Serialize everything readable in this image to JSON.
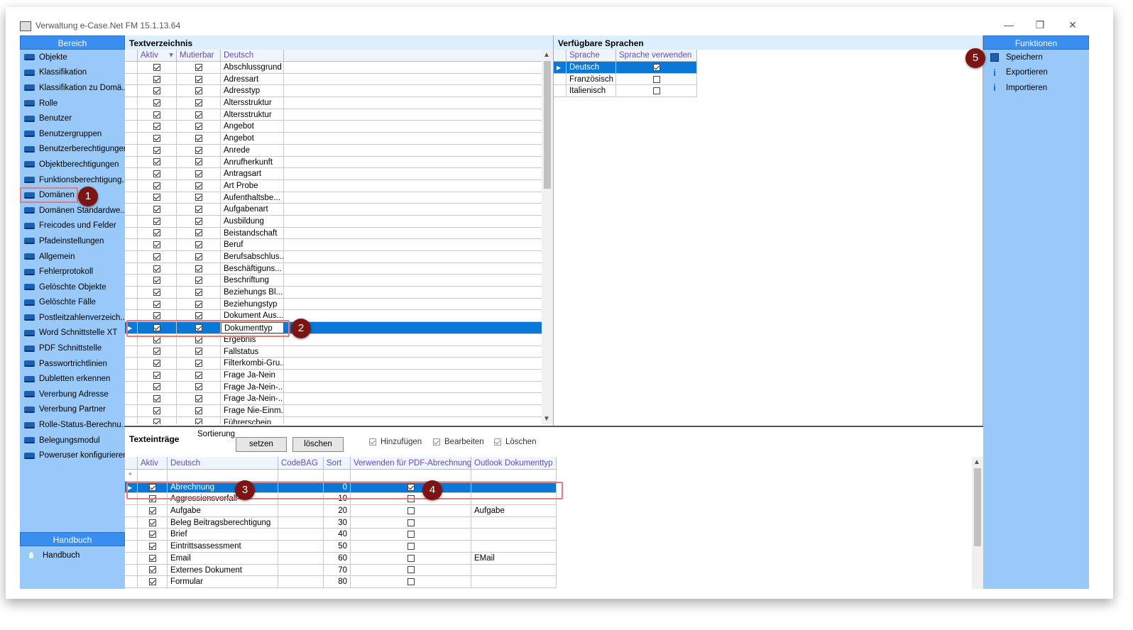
{
  "window": {
    "title": "Verwaltung e-Case.Net FM 15.1.13.64",
    "minimize": "—",
    "restore": "❐",
    "close": "✕"
  },
  "bereich": {
    "header": "Bereich",
    "items": [
      "Objekte",
      "Klassifikation",
      "Klassifikation zu Domä...",
      "Rolle",
      "Benutzer",
      "Benutzergruppen",
      "Benutzerberechtigungen",
      "Objektberechtigungen",
      "Funktionsberechtigung...",
      "Domänen",
      "Domänen Standardwe...",
      "Freicodes und Felder",
      "Pfadeinstellungen",
      "Allgemein",
      "Fehlerprotokoll",
      "Gelöschte Objekte",
      "Gelöschte Fälle",
      "Postleitzahlenverzeich...",
      "Word Schnittstelle XT",
      "PDF Schnittstelle",
      "Passwortrichtlinien",
      "Dubletten erkennen",
      "Vererbung Adresse",
      "Vererbung Partner",
      "Rolle-Status-Berechnu...",
      "Belegungsmodul",
      "Poweruser konfigurieren"
    ],
    "selected_index": 9
  },
  "handbuch": {
    "header": "Handbuch",
    "item": "Handbuch"
  },
  "textverzeichnis": {
    "title": "Textverzeichnis",
    "columns": [
      "Aktiv",
      "Mutierbar",
      "Deutsch"
    ],
    "rows": [
      "Abschlussgrund",
      "Adressart",
      "Adresstyp",
      "Altersstruktur",
      "Altersstruktur",
      "Angebot",
      "Angebot",
      "Anrede",
      "Anrufherkunft",
      "Antragsart",
      "Art Probe",
      "Aufenthaltsbe...",
      "Aufgabenart",
      "Ausbildung",
      "Beistandschaft",
      "Beruf",
      "Berufsabschlus...",
      "Beschäftiguns...",
      "Beschriftung",
      "Beziehungs Bl...",
      "Beziehungstyp",
      "Dokument Aus...",
      "Dokumenttyp",
      "Ergebnis",
      "Fallstatus",
      "Filterkombi-Gru...",
      "Frage Ja-Nein",
      "Frage Ja-Nein-...",
      "Frage Ja-Nein-...",
      "Frage Nie-Einm...",
      "Führerschein"
    ],
    "selected_index": 22,
    "sort_arrow": "▾"
  },
  "sprachen": {
    "title": "Verfügbare Sprachen",
    "columns": [
      "Sprache",
      "Sprache verwenden"
    ],
    "rows": [
      {
        "name": "Deutsch",
        "use": true
      },
      {
        "name": "Französisch",
        "use": false
      },
      {
        "name": "Italienisch",
        "use": false
      }
    ],
    "selected_index": 0
  },
  "funktionen": {
    "header": "Funktionen",
    "items": [
      {
        "label": "Speichern",
        "icon": "save-icon"
      },
      {
        "label": "Exportieren",
        "icon": "info-icon"
      },
      {
        "label": "Importieren",
        "icon": "info-icon"
      }
    ]
  },
  "texteintraege": {
    "title": "Texteinträge",
    "sort_label": "Sortierung",
    "btn_set": "setzen",
    "btn_delete": "löschen",
    "opt_add": "Hinzufügen",
    "opt_edit": "Bearbeiten",
    "opt_delete": "Löschen",
    "columns": [
      "Aktiv",
      "Deutsch",
      "CodeBAG",
      "Sort",
      "Verwenden für PDF-Abrechnung",
      "Outlook Dokumenttyp"
    ],
    "rows": [
      {
        "deutsch": "Abrechnung",
        "sort": "0",
        "pdf": true,
        "outlook": ""
      },
      {
        "deutsch": "Aggressionsvorfall",
        "sort": "10",
        "pdf": false,
        "outlook": ""
      },
      {
        "deutsch": "Aufgabe",
        "sort": "20",
        "pdf": false,
        "outlook": "Aufgabe"
      },
      {
        "deutsch": "Beleg Beitragsberechtigung",
        "sort": "30",
        "pdf": false,
        "outlook": ""
      },
      {
        "deutsch": "Brief",
        "sort": "40",
        "pdf": false,
        "outlook": ""
      },
      {
        "deutsch": "Eintrittsassessment",
        "sort": "50",
        "pdf": false,
        "outlook": ""
      },
      {
        "deutsch": "Email",
        "sort": "60",
        "pdf": false,
        "outlook": "EMail"
      },
      {
        "deutsch": "Externes Dokument",
        "sort": "70",
        "pdf": false,
        "outlook": ""
      },
      {
        "deutsch": "Formular",
        "sort": "80",
        "pdf": false,
        "outlook": ""
      }
    ],
    "selected_index": 0
  },
  "badges": [
    "1",
    "2",
    "3",
    "4",
    "5"
  ],
  "scroll": {
    "up": "▲",
    "down": "▼"
  },
  "colors": {
    "accent": "#3a8ef0",
    "panel": "#99c9f9",
    "selection": "#0a78d7",
    "badge": "#7d1414",
    "highlight": "#e47c7c"
  }
}
